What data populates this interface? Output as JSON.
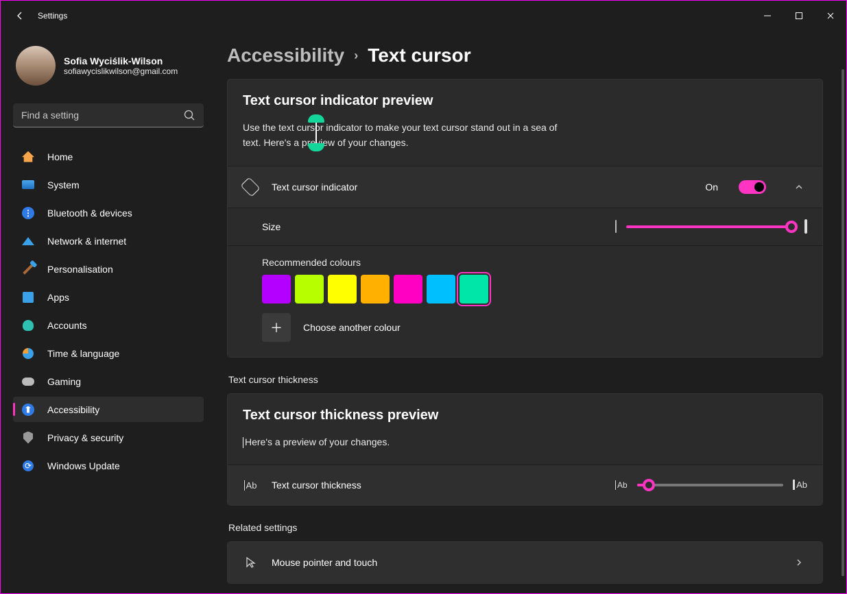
{
  "window": {
    "title": "Settings"
  },
  "user": {
    "name": "Sofia Wyciślik-Wilson",
    "email": "sofiawycislikwilson@gmail.com"
  },
  "search": {
    "placeholder": "Find a setting"
  },
  "nav": [
    {
      "label": "Home",
      "icon": "home"
    },
    {
      "label": "System",
      "icon": "monitor"
    },
    {
      "label": "Bluetooth & devices",
      "icon": "bluetooth"
    },
    {
      "label": "Network & internet",
      "icon": "wifi"
    },
    {
      "label": "Personalisation",
      "icon": "brush"
    },
    {
      "label": "Apps",
      "icon": "apps"
    },
    {
      "label": "Accounts",
      "icon": "user"
    },
    {
      "label": "Time & language",
      "icon": "clock"
    },
    {
      "label": "Gaming",
      "icon": "game"
    },
    {
      "label": "Accessibility",
      "icon": "access",
      "active": true
    },
    {
      "label": "Privacy & security",
      "icon": "shield"
    },
    {
      "label": "Windows Update",
      "icon": "sync"
    }
  ],
  "breadcrumb": {
    "parent": "Accessibility",
    "current": "Text cursor"
  },
  "indicator_preview": {
    "title": "Text cursor indicator preview",
    "body": "Use the text cursor indicator to make your text cursor stand out in a sea of text. Here's a preview of your changes."
  },
  "indicator": {
    "label": "Text cursor indicator",
    "state_text": "On",
    "on": true,
    "size_label": "Size",
    "size_value": 100,
    "colours_label": "Recommended colours",
    "colours": [
      "#b400ff",
      "#b7ff00",
      "#ffff00",
      "#ffb000",
      "#ff00c3",
      "#00bfff",
      "#00e6a8"
    ],
    "selected_colour_index": 6,
    "another_colour_label": "Choose another colour"
  },
  "thickness_section_title": "Text cursor thickness",
  "thickness_preview": {
    "title": "Text cursor thickness preview",
    "body": "Here's a preview of your changes."
  },
  "thickness": {
    "label": "Text cursor thickness",
    "value": 8
  },
  "related": {
    "title": "Related settings",
    "item1": "Mouse pointer and touch"
  }
}
